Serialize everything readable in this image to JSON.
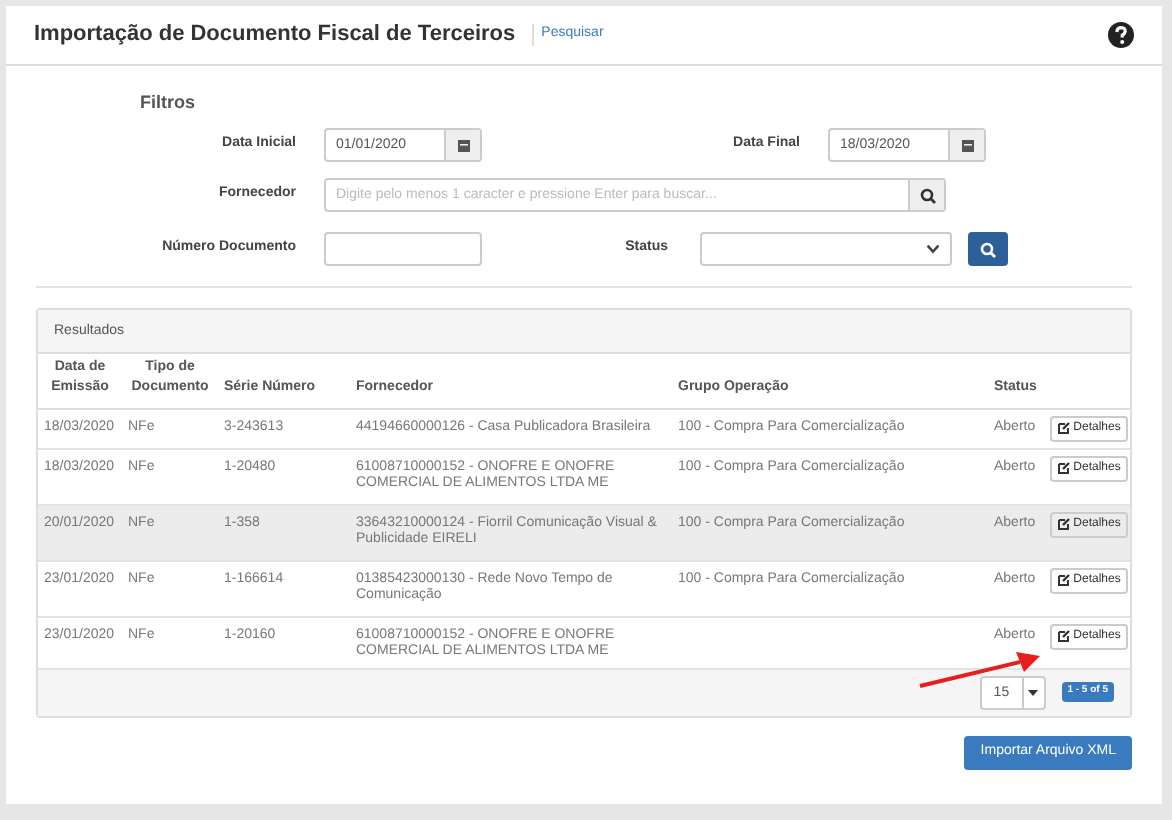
{
  "header": {
    "title": "Importação de Documento Fiscal de Terceiros",
    "breadcrumb": "Pesquisar"
  },
  "filters": {
    "title": "Filtros",
    "data_inicial": {
      "label": "Data Inicial",
      "value": "01/01/2020"
    },
    "data_final": {
      "label": "Data Final",
      "value": "18/03/2020"
    },
    "fornecedor": {
      "label": "Fornecedor",
      "placeholder": "Digite pelo menos 1 caracter e pressione Enter para buscar..."
    },
    "numero": {
      "label": "Número Documento"
    },
    "status": {
      "label": "Status"
    }
  },
  "results": {
    "title": "Resultados",
    "columns": [
      "Data de Emissão",
      "Tipo de Documento",
      "Série Número",
      "Fornecedor",
      "Grupo Operação",
      "Status"
    ],
    "rows": [
      {
        "date": "18/03/2020",
        "type": "NFe",
        "serie": "3-243613",
        "supplier": "44194660000126 - Casa Publicadora Brasileira",
        "group": "100 - Compra Para Comercialização",
        "status": "Aberto",
        "action": "Detalhes",
        "hovered": false
      },
      {
        "date": "18/03/2020",
        "type": "NFe",
        "serie": "1-20480",
        "supplier": "61008710000152 - ONOFRE E ONOFRE COMERCIAL DE ALIMENTOS LTDA ME",
        "group": "100 - Compra Para Comercialização",
        "status": "Aberto",
        "action": "Detalhes",
        "hovered": false
      },
      {
        "date": "20/01/2020",
        "type": "NFe",
        "serie": "1-358",
        "supplier": "33643210000124 - Fiorril Comunicação Visual & Publicidade EIRELI",
        "group": "100 - Compra Para Comercialização",
        "status": "Aberto",
        "action": "Detalhes",
        "hovered": true
      },
      {
        "date": "23/01/2020",
        "type": "NFe",
        "serie": "1-166614",
        "supplier": "01385423000130 - Rede Novo Tempo de Comunicação",
        "group": "100 - Compra Para Comercialização",
        "status": "Aberto",
        "action": "Detalhes",
        "hovered": false
      },
      {
        "date": "23/01/2020",
        "type": "NFe",
        "serie": "1-20160",
        "supplier": "61008710000152 - ONOFRE E ONOFRE COMERCIAL DE ALIMENTOS LTDA ME",
        "status": "Aberto",
        "action": "Detalhes",
        "hovered": false
      }
    ],
    "page_size": "15",
    "range": "1 - 5 of 5"
  },
  "import_button": "Importar Arquivo XML"
}
